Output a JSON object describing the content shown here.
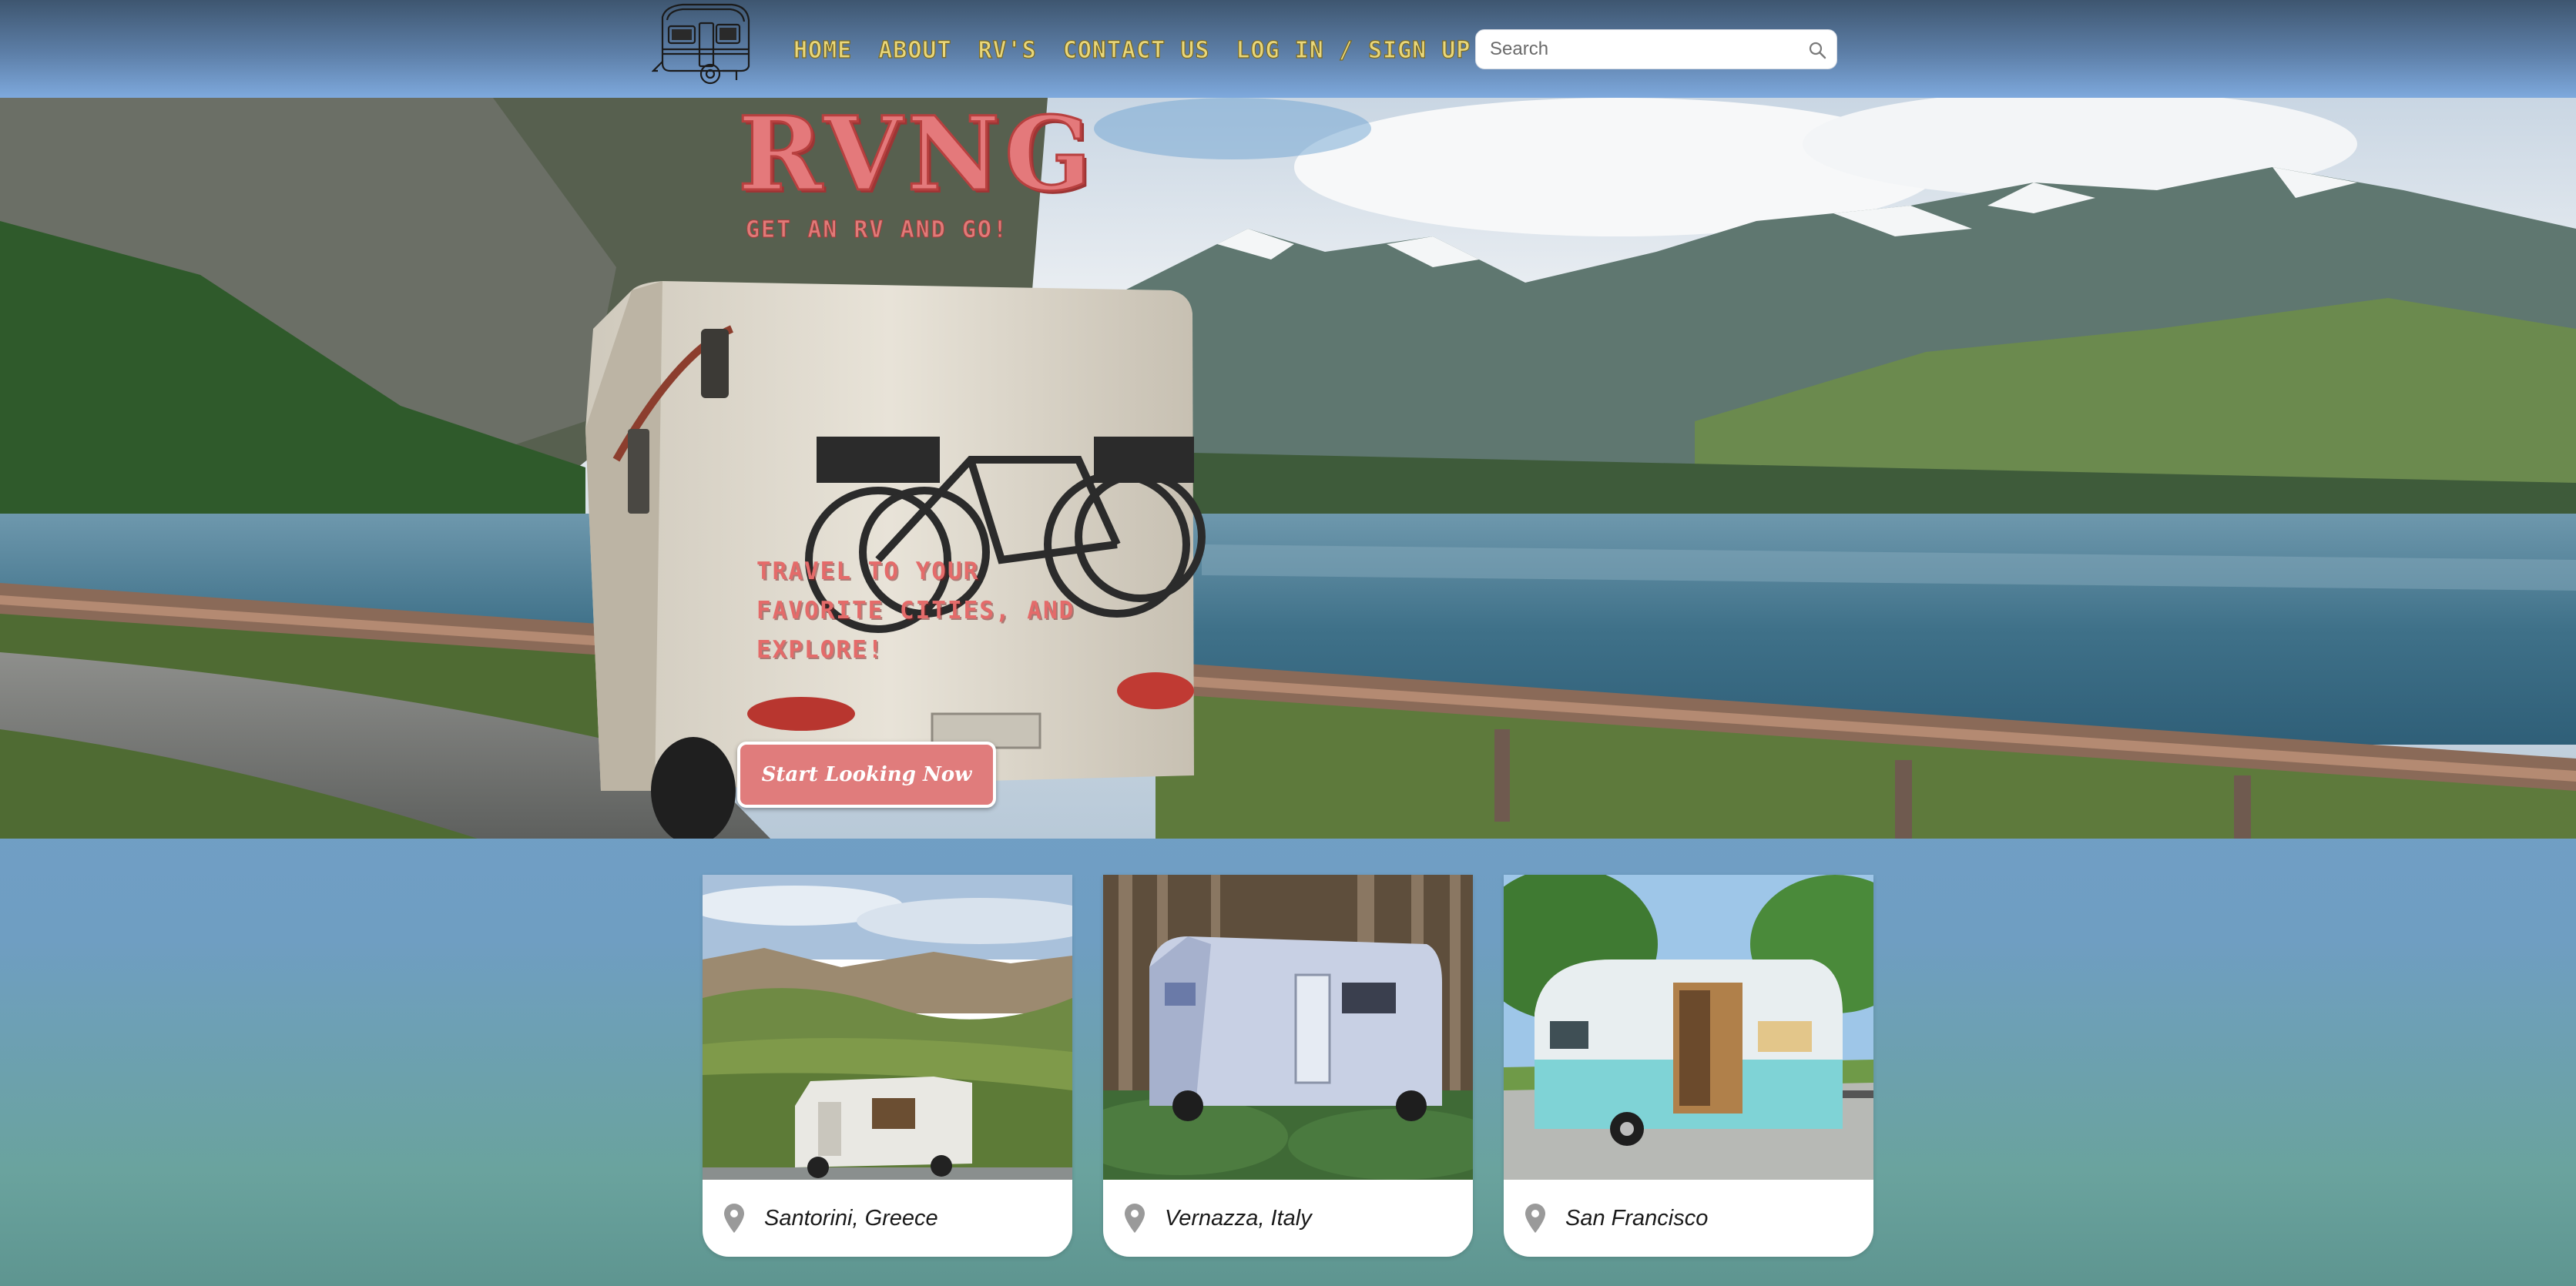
{
  "nav": {
    "logo_icon": "camper-trailer-icon",
    "links": [
      "Home",
      "About",
      "RV's",
      "Contact Us",
      "Log In / Sign Up"
    ],
    "search": {
      "placeholder": "Search",
      "icon": "search-icon"
    }
  },
  "hero": {
    "title": "RVNG",
    "subtitle": "Get an RV and go!",
    "tagline": "Travel to your favorite cities, and explore!",
    "cta_label": "Start Looking Now"
  },
  "cards": [
    {
      "label": "Santorini, Greece",
      "icon": "location-pin-icon"
    },
    {
      "label": "Vernazza, Italy",
      "icon": "location-pin-icon"
    },
    {
      "label": "San Francisco",
      "icon": "location-pin-icon"
    }
  ],
  "colors": {
    "accent": "#e07c7c",
    "nav_text": "#e9d77a",
    "nav_bg_top": "#3e5670",
    "page_bg": "#76a4d8"
  }
}
